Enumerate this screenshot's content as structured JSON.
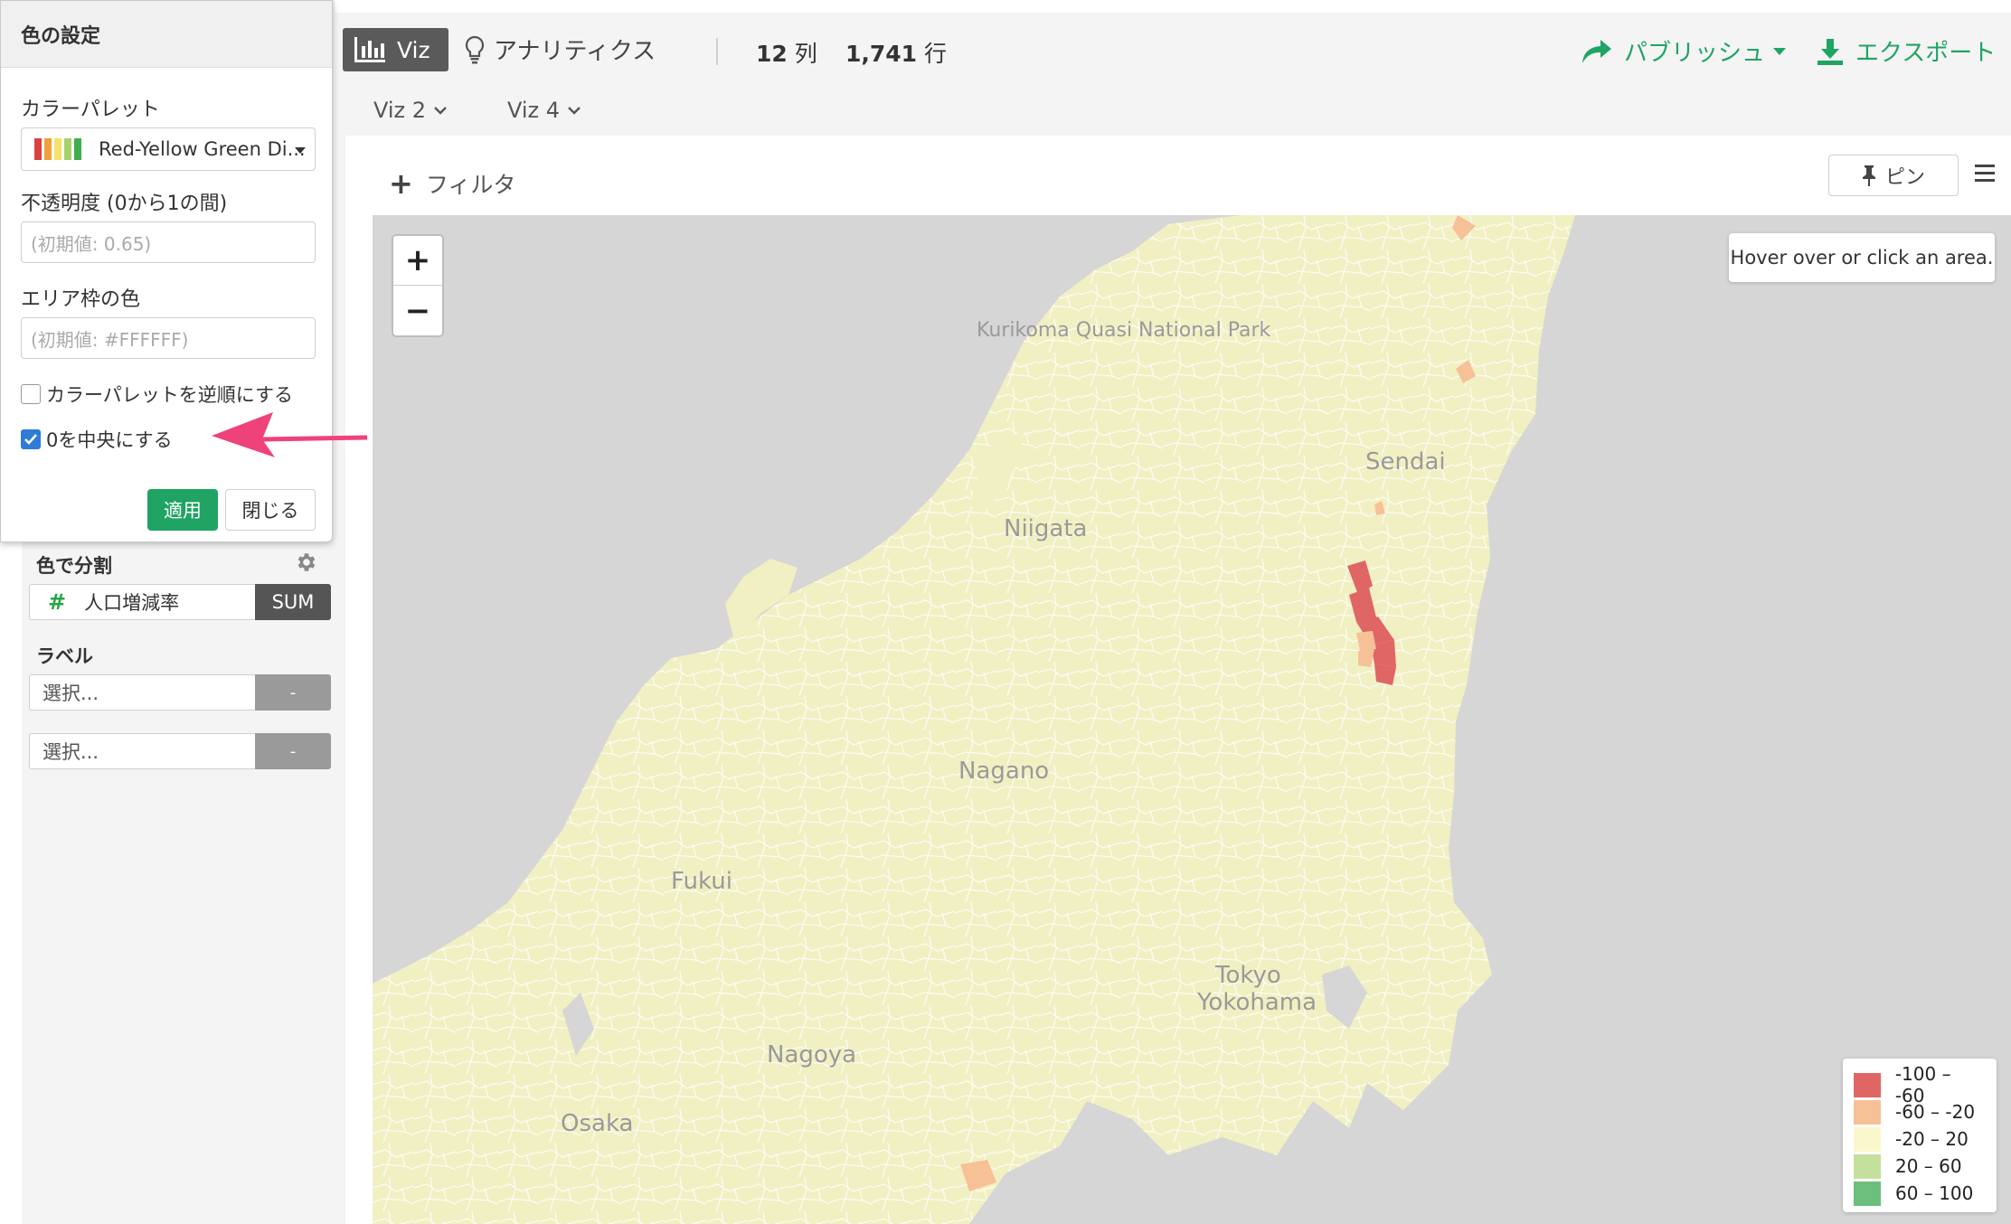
{
  "toolbar": {
    "viz_tab": "Viz",
    "analytics": "アナリティクス",
    "columns_count": "12",
    "columns_unit": "列",
    "rows_count": "1,741",
    "rows_unit": "行",
    "publish": "パブリッシュ",
    "export": "エクスポート",
    "subtabs": [
      "Viz 2",
      "Viz 4"
    ]
  },
  "filter": {
    "label": "フィルタ"
  },
  "pin": {
    "label": "ピン"
  },
  "left_panel": {
    "color_split": {
      "title": "色で分割",
      "field": "人口増減率",
      "agg": "SUM"
    },
    "label": {
      "title": "ラベル",
      "select1": "選択...",
      "select2": "選択...",
      "tag": "-"
    }
  },
  "popup": {
    "title": "色の設定",
    "palette_label": "カラーパレット",
    "palette_value": "Red-Yellow Green Di...",
    "opacity_label": "不透明度 (0から1の間)",
    "opacity_placeholder": "(初期値: 0.65)",
    "border_label": "エリア枠の色",
    "border_placeholder": "(初期値: #FFFFFF)",
    "reverse_label": "カラーパレットを逆順にする",
    "reverse_checked": false,
    "center_zero_label": "0を中央にする",
    "center_zero_checked": true,
    "apply": "適用",
    "close": "閉じる"
  },
  "map": {
    "hover_text": "Hover over or click an area.",
    "zoom_in": "+",
    "zoom_out": "−",
    "cities": [
      "Sendai",
      "Niigata",
      "Nagano",
      "Fukui",
      "Tokyo",
      "Yokohama",
      "Nagoya",
      "Osaka",
      "Kurikoma Quasi National Park"
    ],
    "legend": [
      {
        "range": "-100 – -60",
        "color": "#e06666"
      },
      {
        "range": "-60 – -20",
        "color": "#f6c197"
      },
      {
        "range": "-20 – 20",
        "color": "#fbf7cc"
      },
      {
        "range": "20 – 60",
        "color": "#c3e19c"
      },
      {
        "range": "60 – 100",
        "color": "#6cbf7c"
      }
    ]
  },
  "colors": {
    "accent_green": "#1fa463",
    "land": "#f1f0c3",
    "water": "#d6d6d6",
    "annotation_arrow": "#f0427a"
  }
}
